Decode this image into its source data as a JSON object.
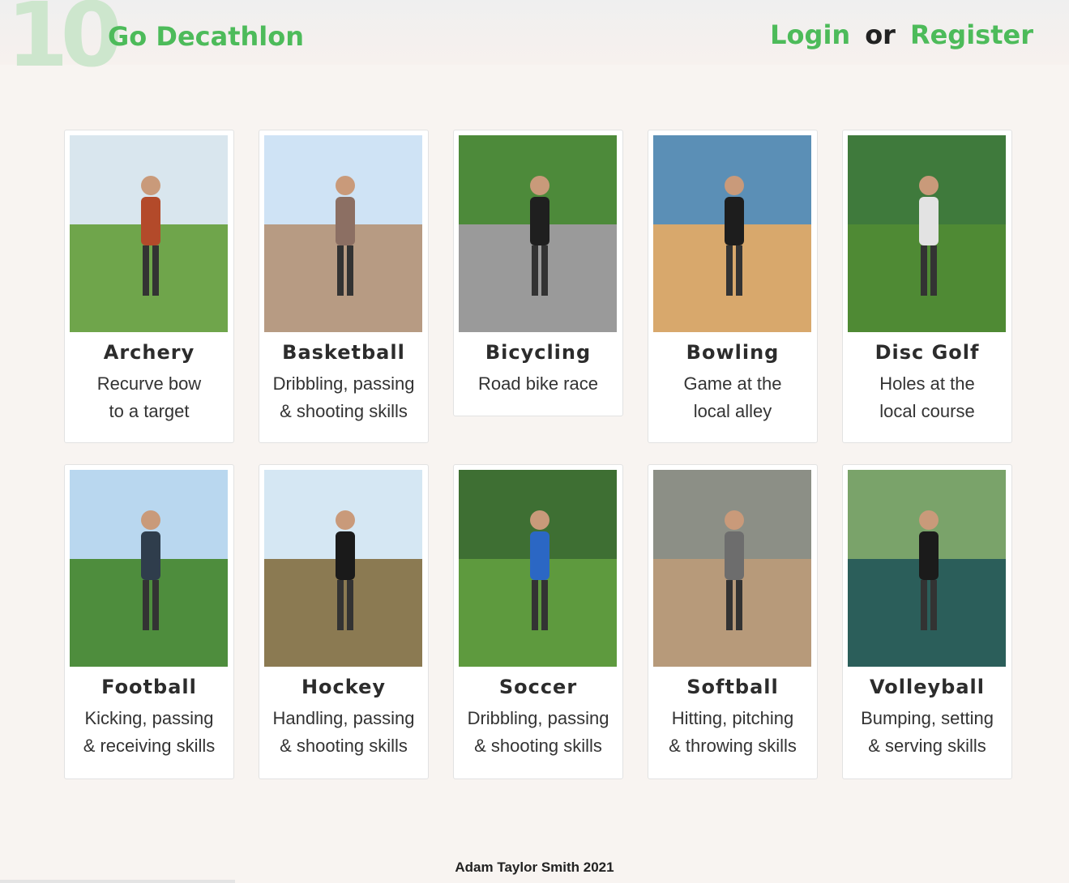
{
  "header": {
    "logo_text": "10",
    "site_title": "Go Decathlon",
    "login_label": "Login",
    "or_label": "or",
    "register_label": "Register"
  },
  "cards": [
    {
      "name": "archery",
      "title": "Archery",
      "line1": "Recurve bow",
      "line2": "to a target",
      "sky": "#d9e6ee",
      "ground": "#6fa54b",
      "figure": "#b34a2a"
    },
    {
      "name": "basketball",
      "title": "Basketball",
      "line1": "Dribbling, passing",
      "line2": "& shooting skills",
      "sky": "#cfe3f5",
      "ground": "#b79b83",
      "figure": "#8c6f63"
    },
    {
      "name": "bicycling",
      "title": "Bicycling",
      "line1": "Road bike race",
      "line2": "",
      "sky": "#4d8a3a",
      "ground": "#9a9a9a",
      "figure": "#1f1f1f"
    },
    {
      "name": "bowling",
      "title": "Bowling",
      "line1": "Game at the",
      "line2": "local alley",
      "sky": "#5b8fb6",
      "ground": "#d8a86c",
      "figure": "#1d1d1d"
    },
    {
      "name": "disc-golf",
      "title": "Disc Golf",
      "line1": "Holes at the",
      "line2": "local course",
      "sky": "#3f7a3c",
      "ground": "#4f8a34",
      "figure": "#e3e3e3"
    },
    {
      "name": "football",
      "title": "Football",
      "line1": "Kicking, passing",
      "line2": "& receiving skills",
      "sky": "#b9d7ef",
      "ground": "#4e8d3d",
      "figure": "#2f3d4c"
    },
    {
      "name": "hockey",
      "title": "Hockey",
      "line1": "Handling, passing",
      "line2": "& shooting skills",
      "sky": "#d5e7f3",
      "ground": "#8b7a52",
      "figure": "#1a1a1a"
    },
    {
      "name": "soccer",
      "title": "Soccer",
      "line1": "Dribbling, passing",
      "line2": "& shooting skills",
      "sky": "#3e6f33",
      "ground": "#5e9a3e",
      "figure": "#2b67c4"
    },
    {
      "name": "softball",
      "title": "Softball",
      "line1": "Hitting, pitching",
      "line2": "& throwing skills",
      "sky": "#8c8f86",
      "ground": "#b79a7a",
      "figure": "#6d6d6d"
    },
    {
      "name": "volleyball",
      "title": "Volleyball",
      "line1": "Bumping, setting",
      "line2": "& serving skills",
      "sky": "#7aa36a",
      "ground": "#2b5e5a",
      "figure": "#1b1b1b"
    }
  ],
  "footer": {
    "credit": "Adam Taylor Smith  2021"
  }
}
